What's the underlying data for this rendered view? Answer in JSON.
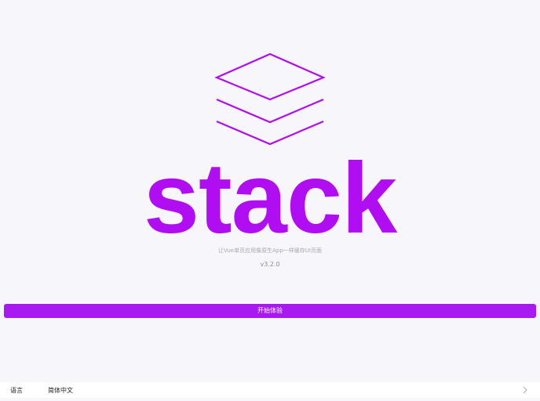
{
  "app": {
    "logo_icon": "stack-layers-icon",
    "title": "stack",
    "subtitle": "让Vue单页应用像原生App一样缓存UI页面",
    "version": "v3.2.0",
    "start_button_label": "开始体验"
  },
  "settings": {
    "language_label": "语言",
    "language_value": "简体中文",
    "chevron_icon": "chevron-right-icon"
  },
  "colors": {
    "accent": "#b00df3",
    "button": "#a818f0",
    "background": "#f7f6fa"
  }
}
